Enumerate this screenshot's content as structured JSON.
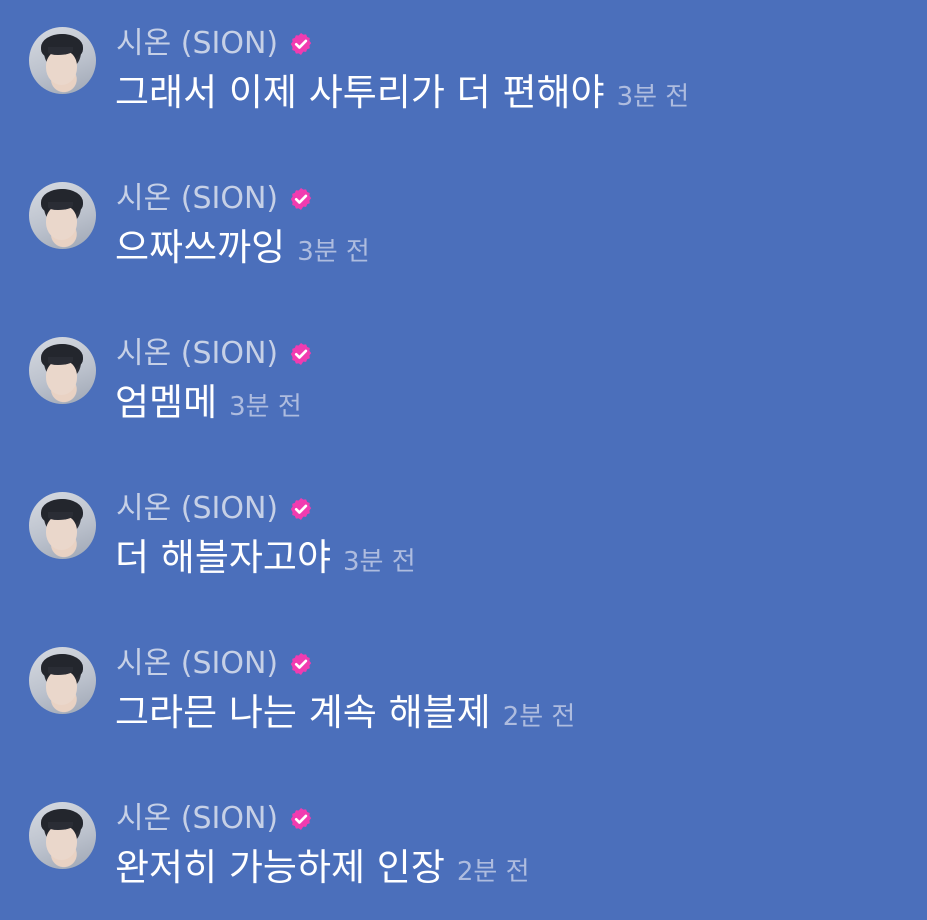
{
  "messages": [
    {
      "author": "시온 (SION)",
      "text": "그래서 이제 사투리가 더 편해야",
      "time": "3분 전"
    },
    {
      "author": "시온 (SION)",
      "text": "으짜쓰까잉",
      "time": "3분 전"
    },
    {
      "author": "시온 (SION)",
      "text": "엄멤메",
      "time": "3분 전"
    },
    {
      "author": "시온 (SION)",
      "text": "더 해블자고야",
      "time": "3분 전"
    },
    {
      "author": "시온 (SION)",
      "text": "그라믄 나는 계속 해블제",
      "time": "2분 전"
    },
    {
      "author": "시온 (SION)",
      "text": "완저히 가능하제 인장",
      "time": "2분 전"
    }
  ],
  "icons": {
    "verified": "verified-badge-icon",
    "avatar": "profile-avatar"
  },
  "colors": {
    "background": "#4b6fbb",
    "badge": "#f13bb0",
    "name": "#c6d0e6",
    "message": "#ffffff",
    "time": "#aebcdf"
  }
}
